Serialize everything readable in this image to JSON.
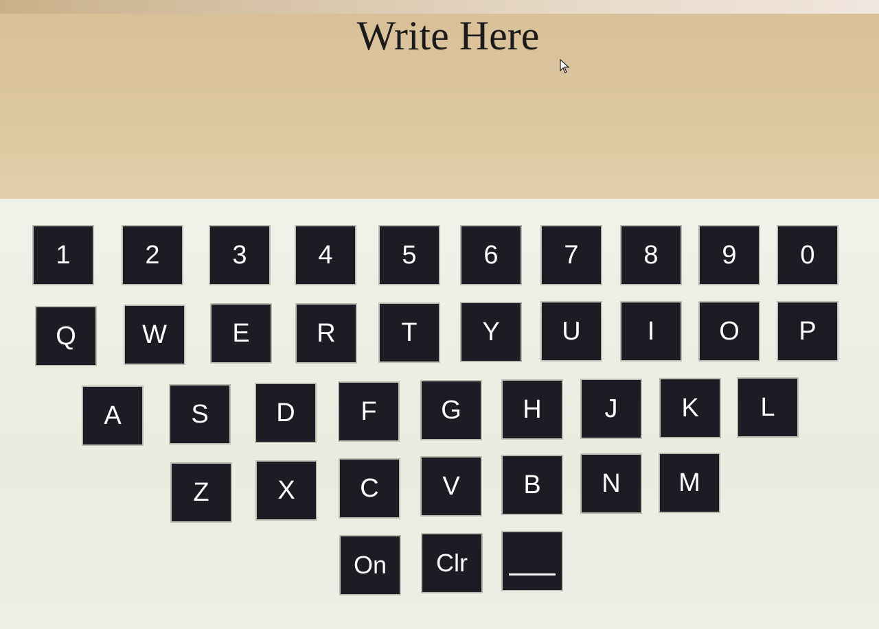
{
  "header": {
    "title": "Write Here"
  },
  "keyboard": {
    "row_numbers": [
      "1",
      "2",
      "3",
      "4",
      "5",
      "6",
      "7",
      "8",
      "9",
      "0"
    ],
    "row_q": [
      "Q",
      "W",
      "E",
      "R",
      "T",
      "Y",
      "U",
      "I",
      "O",
      "P"
    ],
    "row_a": [
      "A",
      "S",
      "D",
      "F",
      "G",
      "H",
      "J",
      "K",
      "L"
    ],
    "row_z": [
      "Z",
      "X",
      "C",
      "V",
      "B",
      "N",
      "M"
    ],
    "controls": {
      "on_label": "On",
      "clear_label": "Clr",
      "space_icon": "underscore-icon"
    }
  },
  "colors": {
    "key_background": "#1c1d24",
    "key_text": "#ffffff",
    "header_background": "#dcc6a0"
  }
}
